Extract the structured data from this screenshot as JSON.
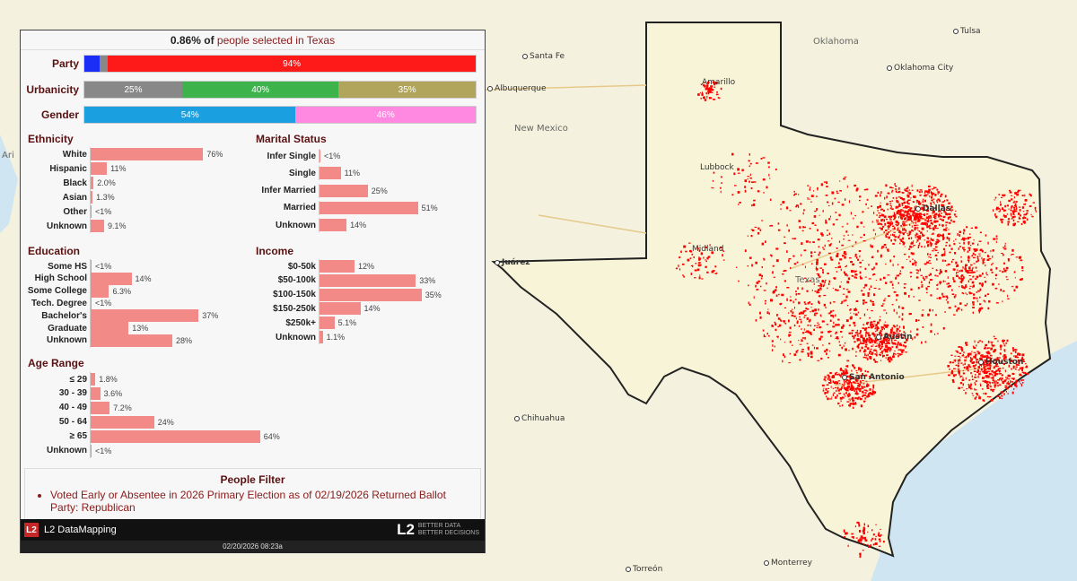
{
  "header": {
    "pct": "0.86% of",
    "rest": "people selected in Texas"
  },
  "party": {
    "label": "Party",
    "segments": [
      {
        "color": "#1a2ef5",
        "value": 4,
        "text": ""
      },
      {
        "color": "#888888",
        "value": 2,
        "text": ""
      },
      {
        "color": "#ff1a1a",
        "value": 94,
        "text": "94%"
      }
    ]
  },
  "urbanicity": {
    "label": "Urbanicity",
    "segments": [
      {
        "color": "#888888",
        "value": 25,
        "text": "25%"
      },
      {
        "color": "#3cb44b",
        "value": 40,
        "text": "40%"
      },
      {
        "color": "#b0a55a",
        "value": 35,
        "text": "35%"
      }
    ]
  },
  "gender": {
    "label": "Gender",
    "segments": [
      {
        "color": "#1aa0e0",
        "value": 54,
        "text": "54%"
      },
      {
        "color": "#ff88e0",
        "value": 46,
        "text": "46%"
      }
    ]
  },
  "ethnicity": {
    "title": "Ethnicity",
    "rows": [
      {
        "label": "White",
        "value": 76,
        "text": "76%"
      },
      {
        "label": "Hispanic",
        "value": 11,
        "text": "11%"
      },
      {
        "label": "Black",
        "value": 2.0,
        "text": "2.0%"
      },
      {
        "label": "Asian",
        "value": 1.3,
        "text": "1.3%"
      },
      {
        "label": "Other",
        "value": 0.3,
        "text": "<1%"
      },
      {
        "label": "Unknown",
        "value": 9.1,
        "text": "9.1%"
      }
    ]
  },
  "marital": {
    "title": "Marital Status",
    "rows": [
      {
        "label": "Infer Single",
        "value": 0.3,
        "text": "<1%"
      },
      {
        "label": "Single",
        "value": 11,
        "text": "11%"
      },
      {
        "label": "Infer Married",
        "value": 25,
        "text": "25%"
      },
      {
        "label": "Married",
        "value": 51,
        "text": "51%"
      },
      {
        "label": "Unknown",
        "value": 14,
        "text": "14%"
      }
    ]
  },
  "education": {
    "title": "Education",
    "rows": [
      {
        "label": "Some HS",
        "value": 0.3,
        "text": "<1%"
      },
      {
        "label": "High School",
        "value": 14,
        "text": "14%"
      },
      {
        "label": "Some College",
        "value": 6.3,
        "text": "6.3%"
      },
      {
        "label": "Tech. Degree",
        "value": 0.3,
        "text": "<1%"
      },
      {
        "label": "Bachelor's",
        "value": 37,
        "text": "37%"
      },
      {
        "label": "Graduate",
        "value": 13,
        "text": "13%"
      },
      {
        "label": "Unknown",
        "value": 28,
        "text": "28%"
      }
    ]
  },
  "income": {
    "title": "Income",
    "rows": [
      {
        "label": "$0-50k",
        "value": 12,
        "text": "12%"
      },
      {
        "label": "$50-100k",
        "value": 33,
        "text": "33%"
      },
      {
        "label": "$100-150k",
        "value": 35,
        "text": "35%"
      },
      {
        "label": "$150-250k",
        "value": 14,
        "text": "14%"
      },
      {
        "label": "$250k+",
        "value": 5.1,
        "text": "5.1%"
      },
      {
        "label": "Unknown",
        "value": 1.1,
        "text": "1.1%"
      }
    ]
  },
  "age": {
    "title": "Age Range",
    "rows": [
      {
        "label": "≤ 29",
        "value": 1.8,
        "text": "1.8%"
      },
      {
        "label": "30 - 39",
        "value": 3.6,
        "text": "3.6%"
      },
      {
        "label": "40 - 49",
        "value": 7.2,
        "text": "7.2%"
      },
      {
        "label": "50 - 64",
        "value": 24,
        "text": "24%"
      },
      {
        "label": "≥ 65",
        "value": 64,
        "text": "64%"
      },
      {
        "label": "Unknown",
        "value": 0.3,
        "text": "<1%"
      }
    ]
  },
  "people_filter": {
    "title": "People Filter",
    "item": "Voted Early or Absentee in 2026 Primary Election as of 02/19/2026 Returned Ballot Party: Republican"
  },
  "footer": {
    "logo": "L2",
    "brand": "L2 DataMapping",
    "big": "L2",
    "tag1": "BETTER DATA",
    "tag2": "BETTER DECISIONS",
    "timestamp": "02/20/2026 08:23a"
  },
  "map": {
    "cities": [
      "Santa Fe",
      "Albuquerque",
      "New Mexico",
      "Amarillo",
      "Lubbock",
      "Midland",
      "Juárez",
      "Chihuahua",
      "Torreón",
      "Monterrey",
      "Dallas",
      "Austin",
      "San Antonio",
      "Houston",
      "Texas",
      "Oklahoma",
      "Oklahoma City",
      "Tulsa",
      "Ari"
    ],
    "dot_color": "#ff0000"
  }
}
